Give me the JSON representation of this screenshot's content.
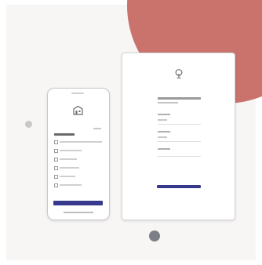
{
  "palette": {
    "panel": "#f7f6f5",
    "blob": "#c9736c",
    "button": "#38388c",
    "dot_dark": "#7d7f86"
  },
  "icons": {
    "tablet_logo": "tree-logo-icon",
    "phone_logo": "building-logo-icon"
  },
  "phone": {
    "rows": [
      {
        "name": "phone-row-1"
      },
      {
        "name": "phone-row-2"
      },
      {
        "name": "phone-row-3"
      },
      {
        "name": "phone-row-4"
      },
      {
        "name": "phone-row-5"
      },
      {
        "name": "phone-row-6"
      }
    ]
  }
}
